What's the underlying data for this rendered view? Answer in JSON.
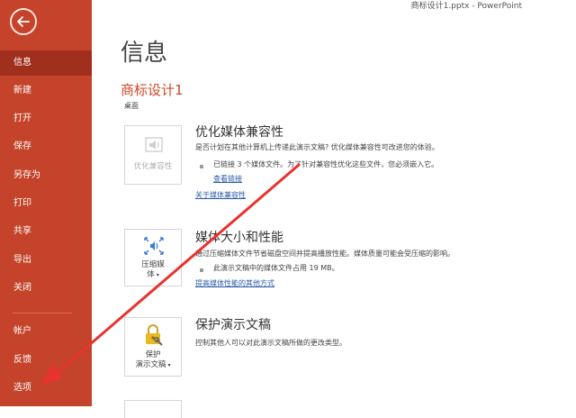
{
  "window": {
    "title": "商标设计1.pptx  -  PowerPoint"
  },
  "sidebar": {
    "items": [
      {
        "label": "信息"
      },
      {
        "label": "新建"
      },
      {
        "label": "打开"
      },
      {
        "label": "保存"
      },
      {
        "label": "另存为"
      },
      {
        "label": "打印"
      },
      {
        "label": "共享"
      },
      {
        "label": "导出"
      },
      {
        "label": "关闭"
      },
      {
        "label": "帐户"
      },
      {
        "label": "反馈"
      },
      {
        "label": "选项"
      }
    ]
  },
  "main": {
    "title": "信息",
    "doc_name": "商标设计1",
    "doc_location": "桌面",
    "sections": [
      {
        "tile_label": "优化兼容性",
        "title": "优化媒体兼容性",
        "desc": "是否计划在其他计算机上传递此演示文稿? 优化媒体兼容性可改进您的体验。",
        "bullet": "已链接 3 个媒体文件。为了针对兼容性优化这些文件，您必须嵌入它。",
        "link_inline": "查看链接",
        "link": "关于媒体兼容性"
      },
      {
        "tile_label_1": "压缩媒",
        "tile_label_2": "体",
        "title": "媒体大小和性能",
        "desc": "通过压缩媒体文件节省磁盘空间并提高播放性能。媒体质量可能会受压缩的影响。",
        "bullet": "此演示文稿中的媒体文件占用 19 MB。",
        "link": "提高媒体性能的其他方式"
      },
      {
        "tile_label_1": "保护",
        "tile_label_2": "演示文稿",
        "title": "保护演示文稿",
        "desc": "控制其他人可以对此演示文稿所做的更改类型。"
      }
    ]
  },
  "colors": {
    "sidebar_bg": "#c4432a",
    "sidebar_active": "#a0301d",
    "accent": "#d24726",
    "link": "#2a5aa8",
    "annotation_arrow": "#e8332e"
  }
}
